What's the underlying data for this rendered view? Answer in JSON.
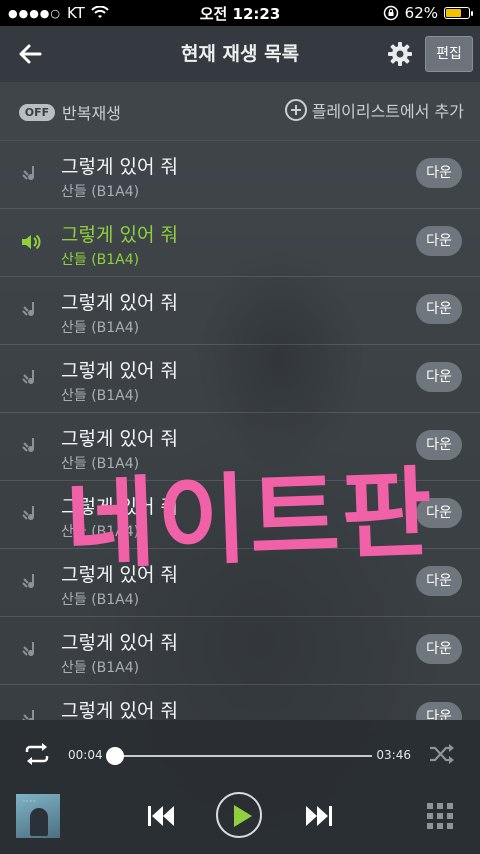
{
  "status": {
    "carrier": "KT",
    "time": "오전 12:23",
    "battery": "62%"
  },
  "header": {
    "title": "현재 재생 목록",
    "edit_label": "편집"
  },
  "options": {
    "repeat_toggle": "OFF",
    "repeat_label": "반복재생",
    "add_playlist_label": "플레이리스트에서 추가"
  },
  "playlist": [
    {
      "song": "그렇게 있어 줘",
      "artist": "산들 (B1A4)",
      "button": "다운",
      "playing": false
    },
    {
      "song": "그렇게 있어 줘",
      "artist": "산들 (B1A4)",
      "button": "다운",
      "playing": true
    },
    {
      "song": "그렇게 있어 줘",
      "artist": "산들 (B1A4)",
      "button": "다운",
      "playing": false
    },
    {
      "song": "그렇게 있어 줘",
      "artist": "산들 (B1A4)",
      "button": "다운",
      "playing": false
    },
    {
      "song": "그렇게 있어 줘",
      "artist": "산들 (B1A4)",
      "button": "다운",
      "playing": false
    },
    {
      "song": "그렇게 있어 줘",
      "artist": "산들 (B1A4)",
      "button": "다운",
      "playing": false
    },
    {
      "song": "그렇게 있어 줘",
      "artist": "산들 (B1A4)",
      "button": "다운",
      "playing": false
    },
    {
      "song": "그렇게 있어 줘",
      "artist": "산들 (B1A4)",
      "button": "다운",
      "playing": false
    },
    {
      "song": "그렇게 있어 줘",
      "artist": "",
      "button": "다운",
      "playing": false
    }
  ],
  "watermark": "네이트판",
  "player": {
    "current_time": "00:04",
    "total_time": "03:46",
    "progress": 0.02
  },
  "colors": {
    "accent": "#8fd13c",
    "watermark": "#f061a8"
  },
  "icons": {
    "back": "arrow-left-icon",
    "settings": "gear-icon",
    "add": "plus-circle-icon",
    "note": "music-note-icon",
    "speaker": "speaker-icon",
    "repeat": "repeat-icon",
    "shuffle": "shuffle-icon",
    "prev": "previous-icon",
    "play": "play-icon",
    "next": "next-icon",
    "menu": "grid-menu-icon"
  }
}
